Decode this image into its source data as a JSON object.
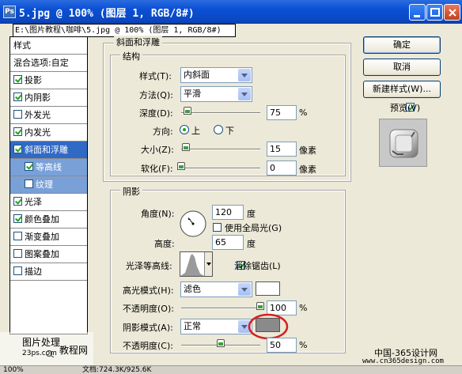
{
  "window": {
    "app_icon": "Ps",
    "title": "5.jpg @ 100% (图层 1, RGB/8#)",
    "tooltip_path": "E:\\图片教程\\咖啡\\5.jpg @ 100% (图层 1, RGB/8#)"
  },
  "left_panel": {
    "items": [
      {
        "label": "样式",
        "checkbox": false
      },
      {
        "label": "混合选项:自定",
        "checkbox": false
      },
      {
        "label": "投影",
        "checkbox": true,
        "checked": true
      },
      {
        "label": "内阴影",
        "checkbox": true,
        "checked": true
      },
      {
        "label": "外发光",
        "checkbox": true,
        "checked": false
      },
      {
        "label": "内发光",
        "checkbox": true,
        "checked": true
      },
      {
        "label": "斜面和浮雕",
        "checkbox": true,
        "checked": true,
        "selected": true
      },
      {
        "label": "等高线",
        "checkbox": true,
        "checked": true,
        "sub": true
      },
      {
        "label": "纹理",
        "checkbox": true,
        "checked": false,
        "sub": true
      },
      {
        "label": "光泽",
        "checkbox": true,
        "checked": true
      },
      {
        "label": "颜色叠加",
        "checkbox": true,
        "checked": true
      },
      {
        "label": "渐变叠加",
        "checkbox": true,
        "checked": false
      },
      {
        "label": "图案叠加",
        "checkbox": true,
        "checked": false
      },
      {
        "label": "描边",
        "checkbox": true,
        "checked": false
      }
    ]
  },
  "bevel": {
    "section_title": "斜面和浮雕",
    "structure_title": "结构",
    "style_label": "样式(T):",
    "style_value": "内斜面",
    "technique_label": "方法(Q):",
    "technique_value": "平滑",
    "depth_label": "深度(D):",
    "depth_value": "75",
    "depth_unit": "%",
    "depth_level": 0.075,
    "direction_label": "方向:",
    "direction_up": "上",
    "direction_down": "下",
    "size_label": "大小(Z):",
    "size_value": "15",
    "size_unit": "像素",
    "size_level": 0.06,
    "soften_label": "软化(F):",
    "soften_value": "0",
    "soften_unit": "像素",
    "soften_level": 0.0
  },
  "shading": {
    "title": "阴影",
    "angle_label": "角度(N):",
    "angle_value": "120",
    "angle_unit": "度",
    "global_light_label": "使用全局光(G)",
    "global_light_checked": false,
    "altitude_label": "高度:",
    "altitude_value": "65",
    "altitude_unit": "度",
    "gloss_contour_label": "光泽等高线:",
    "anti_alias_label": "消除锯齿(L)",
    "anti_alias_checked": true,
    "highlight_mode_label": "高光模式(H):",
    "highlight_mode_value": "滤色",
    "highlight_opacity_label": "不透明度(O):",
    "highlight_opacity_value": "100",
    "highlight_opacity_level": 1.0,
    "shadow_mode_label": "阴影模式(A):",
    "shadow_mode_value": "正常",
    "shadow_opacity_label": "不透明度(C):",
    "shadow_opacity_value": "50",
    "shadow_opacity_level": 0.5,
    "percent": "%",
    "highlight_color": "#ffffff",
    "shadow_color": "#8a8a8a",
    "circle_color": "#d42020"
  },
  "buttons": {
    "ok": "确定",
    "cancel": "取消",
    "new_style": "新建样式(W)...",
    "preview_label": "预览(V)",
    "preview_checked": true
  },
  "watermarks": {
    "left_line1": "图片处理",
    "left_line2": "教程网",
    "left_url": "23ps.com",
    "right_line1": "中国-365设计网",
    "right_url": "www.cn365design.com"
  },
  "status": {
    "zoom": "100%",
    "doc_info": "文档:724.3K/925.6K"
  }
}
